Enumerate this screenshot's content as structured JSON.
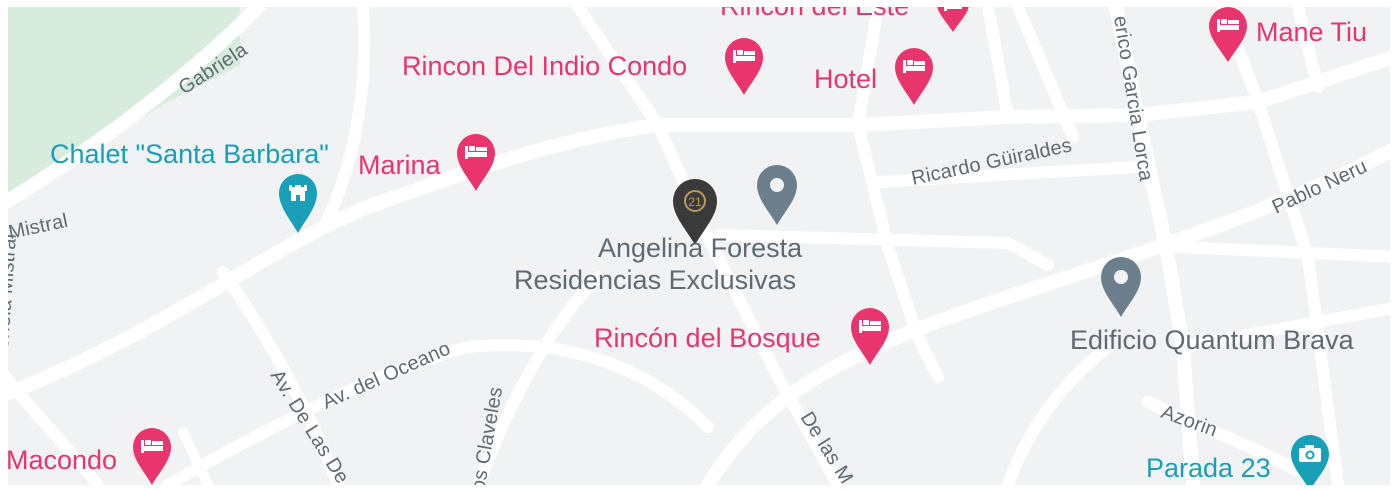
{
  "map": {
    "colors": {
      "background": "#f1f2f4",
      "road": "#ffffff",
      "park": "#d7ecdd",
      "hotel_pin": "#e8356e",
      "attraction_pin": "#1a9fb8",
      "place_pin": "#6d7f8c",
      "featured_pin": "#3a3a3a",
      "street_text": "#5f6a72"
    },
    "streets": [
      {
        "name": "Gabriela"
      },
      {
        "name": "Mistral"
      },
      {
        "name": "Gabriela Mistral"
      },
      {
        "name": "Av. del Oceano"
      },
      {
        "name": "Av. De Las De"
      },
      {
        "name": "os Claveles"
      },
      {
        "name": "De las M"
      },
      {
        "name": "Ricardo Güiraldes"
      },
      {
        "name": "erico Garcia Lorca"
      },
      {
        "name": "Pablo Neru"
      },
      {
        "name": "Azorin"
      }
    ],
    "pois": [
      {
        "name": "Rincon del Este",
        "category": "hotel",
        "icon": "bed-icon"
      },
      {
        "name": "Rincon Del Indio Condo",
        "category": "hotel",
        "icon": "bed-icon"
      },
      {
        "name": "Hotel",
        "category": "hotel",
        "icon": "bed-icon"
      },
      {
        "name": "Mane Tiu",
        "category": "hotel",
        "icon": "bed-icon"
      },
      {
        "name": "Marina",
        "category": "hotel",
        "icon": "bed-icon"
      },
      {
        "name": "Chalet \"Santa Barbara\"",
        "category": "attraction",
        "icon": "castle-icon"
      },
      {
        "name": "Rincón del Bosque",
        "category": "hotel",
        "icon": "bed-icon"
      },
      {
        "name": "Edificio Quantum Brava",
        "category": "place",
        "icon": "place-pin-icon"
      },
      {
        "name": "Macondo",
        "category": "hotel",
        "icon": "bed-icon"
      },
      {
        "name": "Parada 23",
        "category": "attraction",
        "icon": "camera-icon"
      }
    ],
    "featured": {
      "line1": "Angelina Foresta",
      "line2": "Residencias Exclusivas",
      "logo_text": "21",
      "icon": "century21-logo-pin-icon"
    },
    "unnamed_place_pin": {
      "icon": "place-pin-icon"
    }
  }
}
